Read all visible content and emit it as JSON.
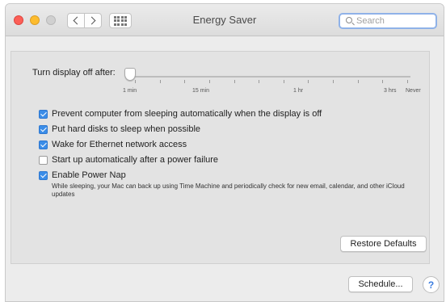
{
  "window": {
    "title": "Energy Saver"
  },
  "toolbar": {
    "back_icon": "chevron-left-icon",
    "forward_icon": "chevron-right-icon",
    "show_all_icon": "grid-icon"
  },
  "search": {
    "placeholder": "Search"
  },
  "display_sleep": {
    "label": "Turn display off after:",
    "tick_labels": [
      "1 min",
      "15 min",
      "1 hr",
      "3 hrs",
      "Never"
    ],
    "value_fraction": 0.0
  },
  "options": [
    {
      "label": "Prevent computer from sleeping automatically when the display is off",
      "checked": true
    },
    {
      "label": "Put hard disks to sleep when possible",
      "checked": true
    },
    {
      "label": "Wake for Ethernet network access",
      "checked": true
    },
    {
      "label": "Start up automatically after a power failure",
      "checked": false
    },
    {
      "label": "Enable Power Nap",
      "checked": true
    }
  ],
  "power_nap_description": "While sleeping, your Mac can back up using Time Machine and periodically check for new email, calendar, and other iCloud updates",
  "buttons": {
    "restore_defaults": "Restore Defaults",
    "schedule": "Schedule...",
    "help": "?"
  },
  "colors": {
    "accent": "#3b8de8",
    "close": "#fc5f57",
    "minimize": "#fdbc2e"
  }
}
